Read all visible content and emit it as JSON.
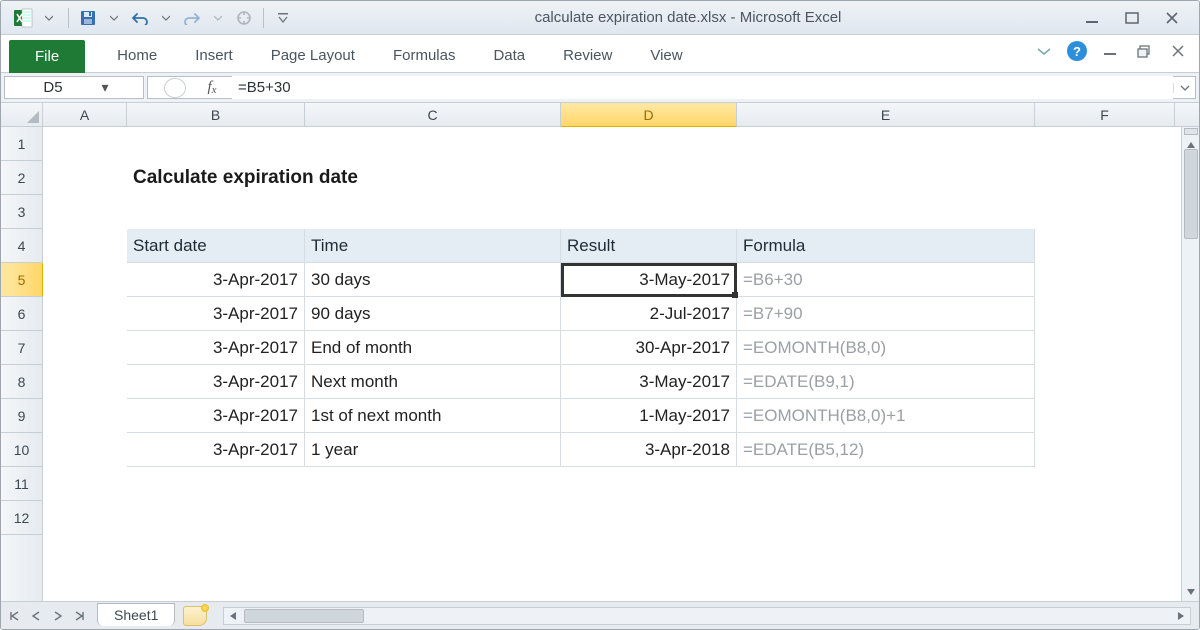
{
  "title": "calculate expiration date.xlsx  -  Microsoft Excel",
  "ribbon": {
    "file": "File",
    "tabs": [
      "Home",
      "Insert",
      "Page Layout",
      "Formulas",
      "Data",
      "Review",
      "View"
    ]
  },
  "name_box": "D5",
  "formula": "=B5+30",
  "columns": [
    "A",
    "B",
    "C",
    "D",
    "E",
    "F"
  ],
  "active_col": "D",
  "active_row": "5",
  "rows": [
    "1",
    "2",
    "3",
    "4",
    "5",
    "6",
    "7",
    "8",
    "9",
    "10",
    "11",
    "12"
  ],
  "sheet": {
    "title": "Calculate expiration date",
    "headers": {
      "start": "Start date",
      "time": "Time",
      "result": "Result",
      "formula": "Formula"
    },
    "data": [
      {
        "start": "3-Apr-2017",
        "time": "30 days",
        "result": "3-May-2017",
        "formula": "=B6+30"
      },
      {
        "start": "3-Apr-2017",
        "time": "90 days",
        "result": "2-Jul-2017",
        "formula": "=B7+90"
      },
      {
        "start": "3-Apr-2017",
        "time": "End of month",
        "result": "30-Apr-2017",
        "formula": "=EOMONTH(B8,0)"
      },
      {
        "start": "3-Apr-2017",
        "time": "Next month",
        "result": "3-May-2017",
        "formula": "=EDATE(B9,1)"
      },
      {
        "start": "3-Apr-2017",
        "time": "1st of next month",
        "result": "1-May-2017",
        "formula": "=EOMONTH(B8,0)+1"
      },
      {
        "start": "3-Apr-2017",
        "time": "1 year",
        "result": "3-Apr-2018",
        "formula": "=EDATE(B5,12)"
      }
    ]
  },
  "sheet_tab": "Sheet1"
}
